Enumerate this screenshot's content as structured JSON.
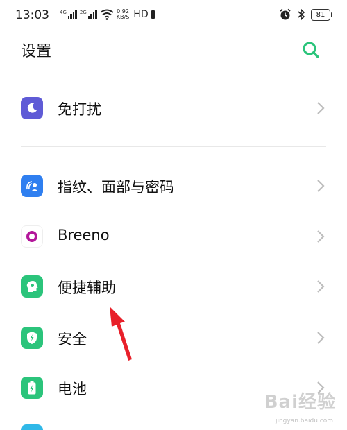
{
  "status_bar": {
    "time": "13:03",
    "signal1_gen": "4G",
    "signal2_gen": "2G",
    "speed_value": "0.92",
    "speed_unit": "KB/S",
    "hd": "HD",
    "battery": "81"
  },
  "header": {
    "title": "设置"
  },
  "items": [
    {
      "label": "免打扰",
      "icon": "moon-icon",
      "color": "#5f5bd6"
    },
    {
      "label": "指纹、面部与密码",
      "icon": "fingerprint-face-icon",
      "color": "#2f7ff0"
    },
    {
      "label": "Breeno",
      "icon": "breeno-icon",
      "color": "#b3179a"
    },
    {
      "label": "便捷辅助",
      "icon": "assist-head-icon",
      "color": "#2bc47b"
    },
    {
      "label": "安全",
      "icon": "shield-icon",
      "color": "#2bc47b"
    },
    {
      "label": "电池",
      "icon": "battery-icon",
      "color": "#2bc47b"
    }
  ],
  "watermark": {
    "brand": "Bai经验",
    "url": "jingyan.baidu.com"
  },
  "colors": {
    "accent": "#2bc47b",
    "arrow": "#e8202a"
  }
}
